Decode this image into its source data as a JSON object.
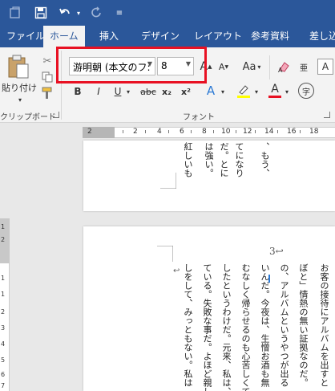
{
  "qat": {
    "autosave_icon": "autosave-icon",
    "save_icon": "save-icon",
    "undo_icon": "undo-icon",
    "redo_icon": "redo-icon",
    "customize_icon": "customize-icon"
  },
  "tabs": [
    {
      "label": "ファイル"
    },
    {
      "label": "ホーム"
    },
    {
      "label": "挿入"
    },
    {
      "label": "デザイン"
    },
    {
      "label": "レイアウト"
    },
    {
      "label": "参考資料"
    },
    {
      "label": "差し込"
    }
  ],
  "clipboard": {
    "paste_label": "貼り付け",
    "group_label": "クリップボード"
  },
  "font": {
    "font_name": "游明朝 (本文のフ:",
    "font_size": "8",
    "group_label": "フォント",
    "grow": "A",
    "shrink": "A",
    "case": "Aa",
    "bold": "B",
    "italic": "I",
    "underline": "U",
    "strike": "abc",
    "subscript": "x₂",
    "superscript": "x²",
    "effects": "A",
    "highlight": "ab",
    "font_color": "A",
    "phonetic": "亜",
    "enclose": "字"
  },
  "ruler": {
    "labels": [
      "2",
      "2",
      "4",
      "6",
      "8",
      "10",
      "12",
      "14",
      "16",
      "18"
    ]
  },
  "vruler": {
    "labels": [
      "1",
      "2",
      "1",
      "1",
      "2",
      "3",
      "4",
      "5",
      "6",
      "7"
    ]
  },
  "page1": {
    "columns": [
      "、もう、",
      "てになり",
      "だ。とに",
      "は強い。",
      "紅しいも"
    ]
  },
  "page2": {
    "page_number": "3↩",
    "columns": [
      "お客の接待にアルバムを出すと",
      "ぼと」情熱の無い証拠なのだ。",
      "の、アルバムというやつが出る",
      "いんだ。今夜は、生憎お酒も無",
      "むなしく帰らせるのも心苦しくて",
      "したというわけだ。元来、私は、",
      "ている。失敗な事だ。よほど親し",
      "しをして、みっともない。私は"
    ],
    "return_mark": "↩"
  },
  "colors": {
    "brand": "#2b579a",
    "highlight_box": "#e81123"
  }
}
